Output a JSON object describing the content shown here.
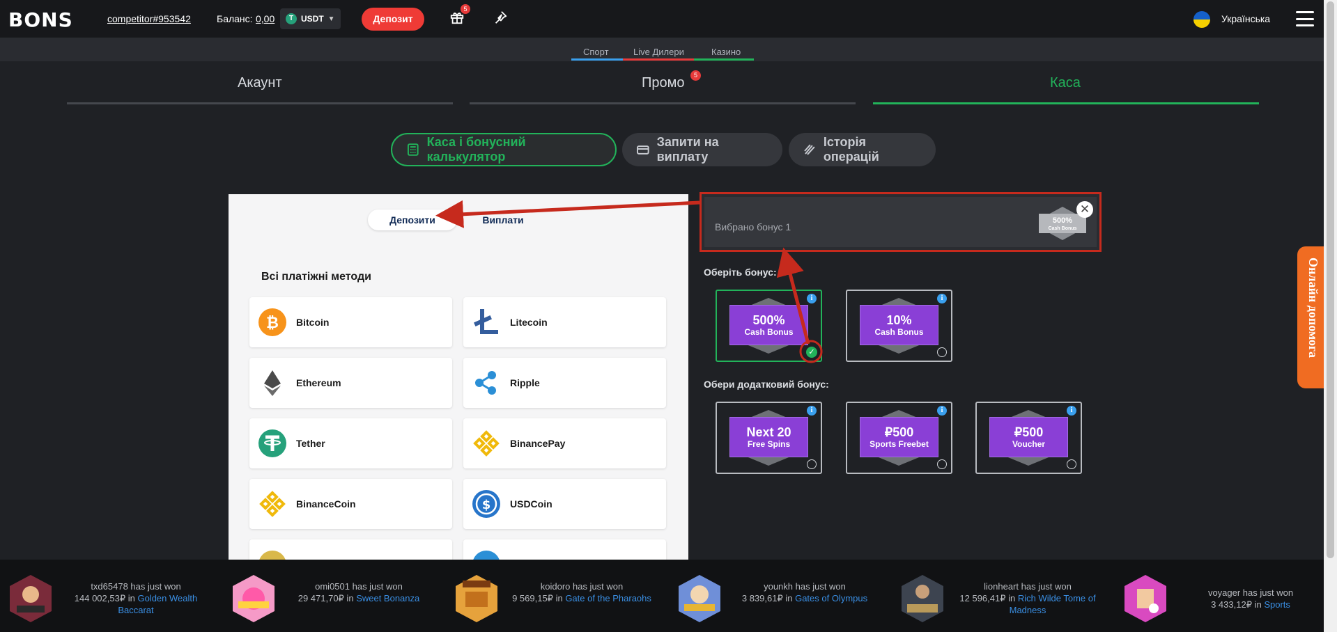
{
  "header": {
    "logo": "BONS",
    "username": "competitor#953542",
    "balance_label": "Баланс:",
    "balance_value": "0,00",
    "currency": "USDT",
    "currency_icon": "T",
    "deposit_button": "Депозит",
    "gift_badge": "5",
    "language": "Українська"
  },
  "subnav": {
    "items": [
      {
        "label": "Спорт",
        "color": "#3aa0ee"
      },
      {
        "label": "Live Дилери",
        "color": "#e73a3a"
      },
      {
        "label": "Казино",
        "color": "#22b35a"
      }
    ]
  },
  "main_tabs": {
    "account": "Акаунт",
    "promo": "Промо",
    "promo_badge": "5",
    "cashier": "Каса",
    "active": "cashier",
    "active_color": "#22b35a"
  },
  "sub_tabs": {
    "cashier_calc": "Каса і бонусний калькулятор",
    "withdraw_requests": "Запити на виплату",
    "history": "Історія операцій"
  },
  "panel": {
    "toggle_deposits": "Депозити",
    "toggle_withdrawals": "Виплати",
    "methods_title": "Всі платіжні методи",
    "methods": [
      {
        "name": "Bitcoin",
        "icon": "bitcoin-icon"
      },
      {
        "name": "Litecoin",
        "icon": "litecoin-icon"
      },
      {
        "name": "Ethereum",
        "icon": "ethereum-icon"
      },
      {
        "name": "Ripple",
        "icon": "ripple-icon"
      },
      {
        "name": "Tether",
        "icon": "tether-icon"
      },
      {
        "name": "BinancePay",
        "icon": "binancepay-icon"
      },
      {
        "name": "BinanceCoin",
        "icon": "binancecoin-icon"
      },
      {
        "name": "USDCoin",
        "icon": "usdcoin-icon"
      }
    ]
  },
  "bonus": {
    "selected_text": "Вибрано бонус 1",
    "mini_big": "500%",
    "mini_small": "Cash Bonus",
    "choose_label": "Оберіть бонус:",
    "choose_extra_label": "Обери додатковий бонус:",
    "main_bonuses": [
      {
        "big": "500%",
        "small": "Cash Bonus",
        "selected": true
      },
      {
        "big": "10%",
        "small": "Cash Bonus",
        "selected": false
      }
    ],
    "extra_bonuses": [
      {
        "big": "Next 20",
        "small": "Free Spins"
      },
      {
        "big": "₽500",
        "small": "Sports Freebet"
      },
      {
        "big": "₽500",
        "small": "Voucher"
      }
    ]
  },
  "help_tab": "Онлайн допомога",
  "ticker": [
    {
      "user": "txd65478 has just won",
      "amount": "144 002,53₽ in",
      "game": "Golden Wealth Baccarat"
    },
    {
      "user": "omi0501 has just won",
      "amount": "29 471,70₽ in",
      "game": "Sweet Bonanza"
    },
    {
      "user": "koidoro has just won",
      "amount": "9 569,15₽ in",
      "game": "Gate of the Pharaohs"
    },
    {
      "user": "younkh has just won",
      "amount": "3 839,61₽ in",
      "game": "Gates of Olympus"
    },
    {
      "user": "lionheart has just won",
      "amount": "12 596,41₽ in",
      "game": "Rich Wilde Tome of Madness"
    },
    {
      "user": "voyager has just won",
      "amount": "3 433,12₽ in",
      "game": "Sports"
    }
  ],
  "colors": {
    "accent_green": "#22b35a",
    "deposit_red": "#ef3b36",
    "bonus_purple": "#8a3fd6",
    "annotation_red": "#c62a1d",
    "help_orange": "#f06c22"
  }
}
